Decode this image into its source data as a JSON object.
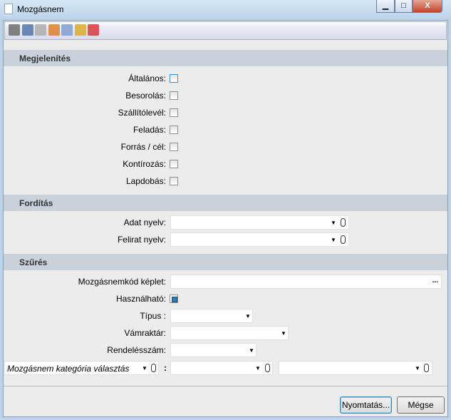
{
  "window": {
    "title": "Mozgásnem",
    "minimize": "▁",
    "maximize": "□",
    "close": "X"
  },
  "toolbar": {
    "icons": [
      "print-icon",
      "preview-icon",
      "copy-icon",
      "edit-icon",
      "calculator-icon",
      "db-import-icon",
      "db-export-icon"
    ],
    "colors": [
      "#666",
      "#4a6fa8",
      "#aaa",
      "#e07a20",
      "#7a9ad0",
      "#d9a820",
      "#d93030"
    ]
  },
  "sections": {
    "display": "Megjelenítés",
    "translation": "Fordítás",
    "filter": "Szűrés"
  },
  "display": [
    {
      "label": "Általános:",
      "checked": false,
      "focused": true
    },
    {
      "label": "Besorolás:",
      "checked": false
    },
    {
      "label": "Szállítólevél:",
      "checked": false
    },
    {
      "label": "Feladás:",
      "checked": false
    },
    {
      "label": "Forrás / cél:",
      "checked": false
    },
    {
      "label": "Kontírozás:",
      "checked": false
    },
    {
      "label": "Lapdobás:",
      "checked": false
    }
  ],
  "translation": {
    "data_lang": "Adat nyelv:",
    "label_lang": "Felirat nyelv:",
    "data_lang_value": "",
    "label_lang_value": ""
  },
  "filter": {
    "code_formula": "Mozgásnemkód képlet:",
    "code_formula_value": "",
    "ellipsis": "...",
    "usable": "Használható:",
    "usable_checked": true,
    "type": "Típus :",
    "customs": "Vámraktár:",
    "order": "Rendelésszám:",
    "category_placeholder": "Mozgásnem kategória választás",
    "colon": ":"
  },
  "buttons": {
    "print": "Nyomtatás...",
    "cancel": "Mégse"
  }
}
